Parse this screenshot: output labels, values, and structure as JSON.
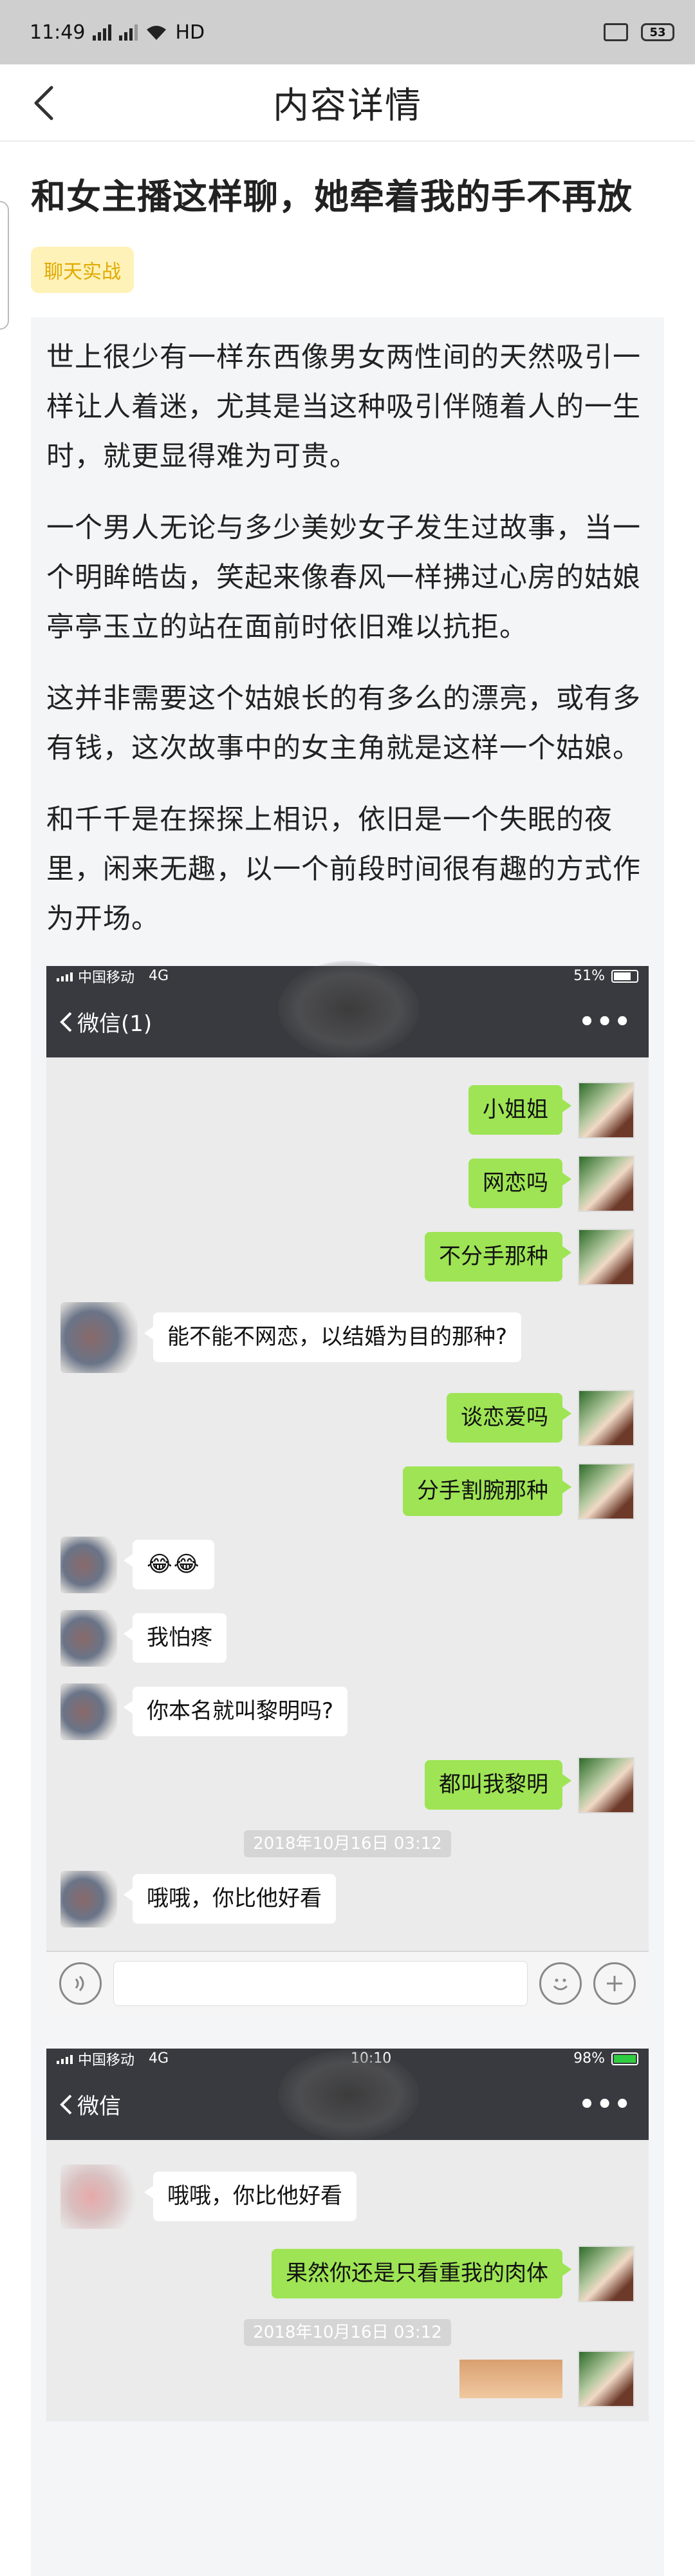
{
  "status_bar": {
    "time": "11:49",
    "net_label": "HD",
    "battery": "53"
  },
  "header": {
    "title": "内容详情"
  },
  "article": {
    "title": "和女主播这样聊，她牵着我的手不再放",
    "tag": "聊天实战",
    "paragraphs": [
      "世上很少有一样东西像男女两性间的天然吸引一样让人着迷，尤其是当这种吸引伴随着人的一生时，就更显得难为可贵。",
      "一个男人无论与多少美妙女子发生过故事，当一个明眸皓齿，笑起来像春风一样拂过心房的姑娘亭亭玉立的站在面前时依旧难以抗拒。",
      "这并非需要这个姑娘长的有多么的漂亮，或有多有钱，这次故事中的女主角就是这样一个姑娘。",
      "和千千是在探探上相识，依旧是一个失眠的夜里，闲来无趣，以一个前段时间很有趣的方式作为开场。"
    ]
  },
  "screenshot1": {
    "carrier": "中国移动",
    "net": "4G",
    "battery": "51%",
    "nav_title": "微信(1)",
    "more": "•••",
    "messages": [
      {
        "side": "me",
        "text": "小姐姐"
      },
      {
        "side": "me",
        "text": "网恋吗"
      },
      {
        "side": "me",
        "text": "不分手那种"
      },
      {
        "side": "them",
        "text": "能不能不网恋，以结婚为目的那种?"
      },
      {
        "side": "me",
        "text": "谈恋爱吗"
      },
      {
        "side": "me",
        "text": "分手割腕那种"
      },
      {
        "side": "them",
        "text": "😂😂"
      },
      {
        "side": "them",
        "text": "我怕疼"
      },
      {
        "side": "them",
        "text": "你本名就叫黎明吗?"
      },
      {
        "side": "me",
        "text": "都叫我黎明"
      }
    ],
    "timestamp": "2018年10月16日 03:12",
    "after_messages": [
      {
        "side": "them",
        "text": "哦哦，你比他好看"
      }
    ]
  },
  "screenshot2": {
    "carrier": "中国移动",
    "net": "4G",
    "time": "10:10",
    "battery": "98%",
    "nav_title": "微信",
    "more": "•••",
    "messages": [
      {
        "side": "them",
        "text": "哦哦，你比他好看"
      },
      {
        "side": "me",
        "text": "果然你还是只看重我的肉体"
      }
    ],
    "timestamp": "2018年10月16日 03:12"
  },
  "icons": {
    "back": "back-chevron-icon",
    "voice": "voice-icon",
    "emoji": "emoji-icon",
    "plus": "plus-icon"
  },
  "colors": {
    "tag_bg": "#fff2b8",
    "tag_text": "#e1aa00",
    "my_bubble": "#9ee454",
    "chat_nav": "#393a3f"
  }
}
